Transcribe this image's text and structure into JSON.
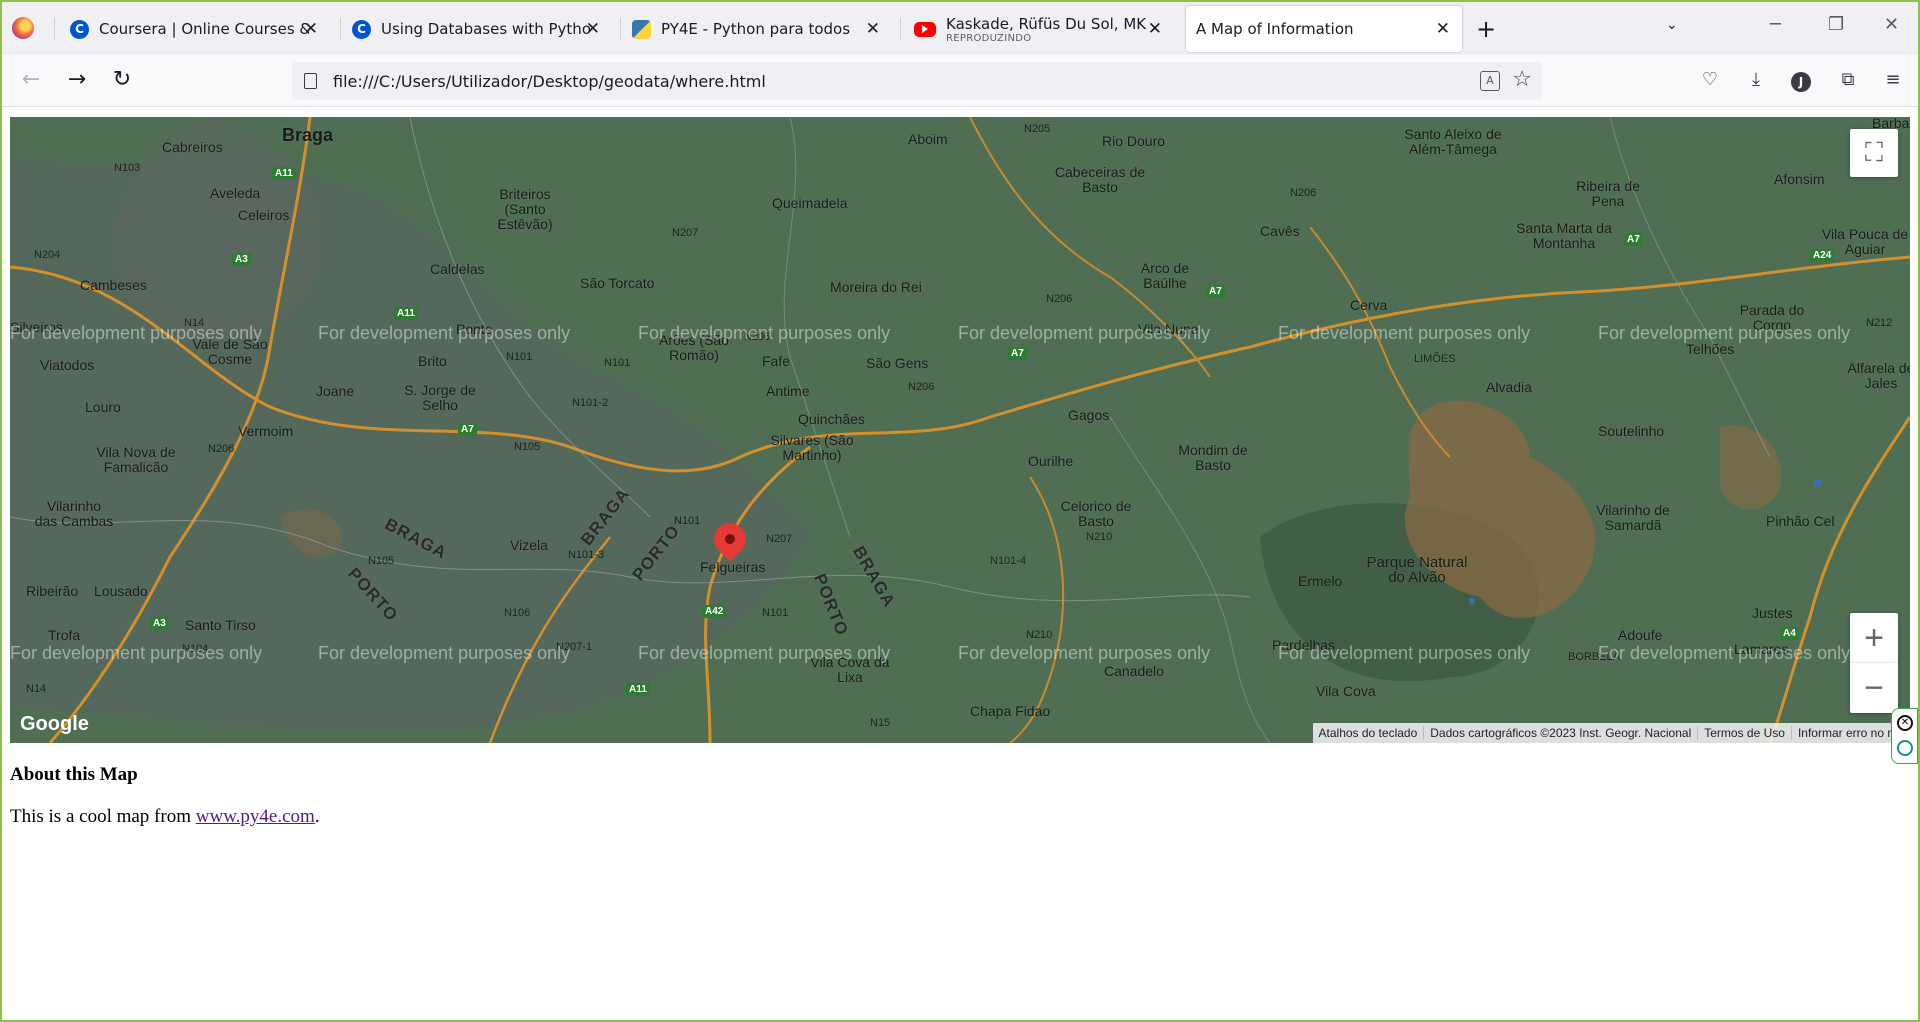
{
  "browser": {
    "tabs": [
      {
        "title": "Coursera | Online Courses & Cre",
        "icon": "coursera-icon"
      },
      {
        "title": "Using Databases with Python -",
        "icon": "coursera-icon"
      },
      {
        "title": "PY4E - Python para todos",
        "icon": "python-icon"
      },
      {
        "title": "Kaskade, Rüfüs Du Sol, MK - Su",
        "subtitle": "REPRODUZINDO",
        "icon": "youtube-icon"
      },
      {
        "title": "A Map of Information",
        "active": true
      }
    ],
    "url": "file:///C:/Users/Utilizador/Desktop/geodata/where.html",
    "avatar_initial": "J",
    "accent_color": "#8bc34a"
  },
  "map": {
    "places": {
      "braga": "Braga",
      "cabreiros": "Cabreiros",
      "aveleda": "Aveleda",
      "celeiros": "Celeiros",
      "briteiros": "Briteiros (Santo Estêvão)",
      "queimadela": "Queimadela",
      "aboim": "Aboim",
      "rio_douro": "Rio Douro",
      "cabeceiras": "Cabeceiras de Basto",
      "santo_aleixo": "Santo Aleixo de Além-Tâmega",
      "ribeira_pena": "Ribeira de Pena",
      "afonsim": "Afonsim",
      "cambeses": "Cambeses",
      "caldelas": "Caldelas",
      "sao_torcato": "São Torcato",
      "moreira_rei": "Moreira do Rei",
      "arco_baulhe": "Arco de Baúlhe",
      "caves": "Cavês",
      "santa_marta": "Santa Marta da Montanha",
      "vila_pouca": "Vila Pouca de Aguiar",
      "silveiros": "Silveiros",
      "ponte": "Ponte",
      "vale_cosme": "Vale de São Cosme",
      "aroes": "Arões (São Romão)",
      "fafe": "Fafe",
      "sao_gens": "São Gens",
      "vila_nune": "Vila Nune",
      "cerva": "Cerva",
      "parada_corgo": "Parada do Corgo",
      "viatodos": "Viatodos",
      "brito": "Brito",
      "joane": "Joane",
      "s_jorge": "S. Jorge de Selho",
      "antime": "Antime",
      "quinchaes": "Quinchães",
      "gagos": "Gagos",
      "limoes": "LIMÕES",
      "telhoes": "Telhões",
      "alfarela": "Alfarela de Jales",
      "louro": "Louro",
      "vermoim": "Vermoim",
      "silvares": "Silvares (São Martinho)",
      "ourilhe": "Ourilhe",
      "mondim": "Mondim de Basto",
      "soutelinho": "Soutelinho",
      "vila_nova": "Vila Nova de Famalicão",
      "vilarinho_cambas": "Vilarinho das Cambas",
      "vizela": "Vizela",
      "felgueiras": "Felgueiras",
      "celorico": "Celorico de Basto",
      "vilarinho_samarda": "Vilarinho de Samardã",
      "pinhao_cel": "Pinhão Cel",
      "ribeirao": "Ribeirão",
      "lousado": "Lousado",
      "ermelo": "Ermelo",
      "parque_alvao": "Parque Natural do Alvão",
      "trofa": "Trofa",
      "santo_tirso": "Santo Tirso",
      "pardelhas": "Pardelhas",
      "adoufe": "Adoufe",
      "justes": "Justes",
      "borbela": "BORBELA",
      "lamares": "Lamares",
      "canadelo": "Canadelo",
      "vila_cova_lixa": "Vila Cova da Lixa",
      "vila_cova": "Vila Cova",
      "chapa": "Chapa Fidao",
      "barba": "Barba",
      "alvadia": "Alvadia"
    },
    "regions": {
      "braga1": "BRAGA",
      "porto1": "PORTO",
      "braga2": "BRAGA",
      "porto2": "PORTO",
      "braga3": "BRAGA",
      "porto3": "PORTO"
    },
    "roads": [
      "N103",
      "A11",
      "N204",
      "A3",
      "N14",
      "A11",
      "N207",
      "N205",
      "N206",
      "N101",
      "N101",
      "N101-2",
      "A7",
      "N105",
      "N206",
      "A7",
      "N206",
      "N206",
      "A7",
      "A7",
      "A24",
      "N212",
      "N101",
      "N101-3",
      "N207",
      "N105",
      "N206",
      "N101-4",
      "N210",
      "A42",
      "N101",
      "N106",
      "N207-1",
      "A11",
      "N104",
      "A3",
      "N14",
      "N210",
      "A4",
      "N15"
    ],
    "watermark": "For development purposes only",
    "controls": {
      "fullscreen_icon": "⛶",
      "zoom_in": "+",
      "zoom_out": "−"
    },
    "google_logo": "Google",
    "attribution": [
      "Atalhos do teclado",
      "Dados cartográficos ©2023 Inst. Geogr. Nacional",
      "Termos de Uso",
      "Informar erro no ma"
    ]
  },
  "content": {
    "heading": "About this Map",
    "text_before": "This is a cool map from ",
    "link_text": "www.py4e.com",
    "text_after": "."
  }
}
